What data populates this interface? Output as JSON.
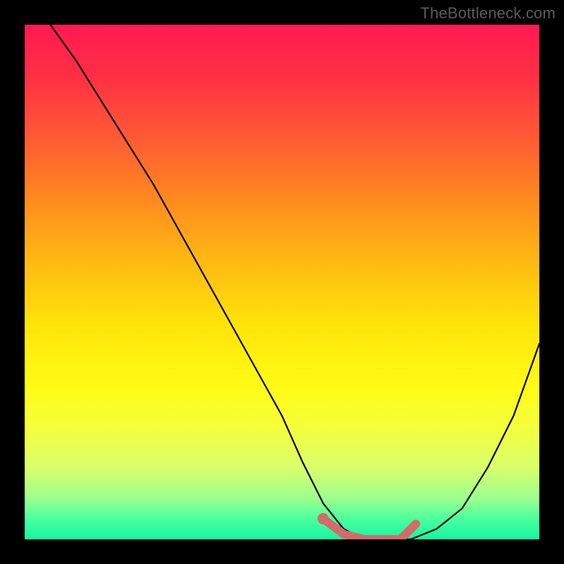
{
  "watermark": "TheBottleneck.com",
  "chart_data": {
    "type": "line",
    "title": "",
    "xlabel": "",
    "ylabel": "",
    "xlim": [
      0,
      100
    ],
    "ylim": [
      0,
      100
    ],
    "series": [
      {
        "name": "curve",
        "color": "#000000",
        "x": [
          5,
          10,
          15,
          20,
          25,
          30,
          35,
          40,
          45,
          50,
          54,
          58,
          62,
          66,
          70,
          75,
          80,
          85,
          90,
          95,
          100
        ],
        "values": [
          100,
          93,
          85,
          77,
          69,
          60,
          51,
          42,
          33,
          24,
          15,
          7,
          2,
          0,
          0,
          0,
          2,
          6,
          14,
          24,
          38
        ]
      },
      {
        "name": "highlight",
        "color": "#d46a6a",
        "x": [
          58,
          62,
          66,
          70,
          73,
          76
        ],
        "values": [
          4,
          1,
          0,
          0,
          0,
          3
        ]
      }
    ],
    "gradient_bands": [
      {
        "pos": 0.0,
        "color": "#ff1a52"
      },
      {
        "pos": 0.1,
        "color": "#ff2f45"
      },
      {
        "pos": 0.22,
        "color": "#ff5a34"
      },
      {
        "pos": 0.34,
        "color": "#ff8a1f"
      },
      {
        "pos": 0.46,
        "color": "#ffb912"
      },
      {
        "pos": 0.58,
        "color": "#ffe309"
      },
      {
        "pos": 0.7,
        "color": "#fffb14"
      },
      {
        "pos": 0.78,
        "color": "#f6ff3a"
      },
      {
        "pos": 0.86,
        "color": "#d9ff6a"
      },
      {
        "pos": 0.92,
        "color": "#9dff8e"
      },
      {
        "pos": 0.96,
        "color": "#4cff9d"
      },
      {
        "pos": 1.0,
        "color": "#12f7a3"
      }
    ]
  }
}
